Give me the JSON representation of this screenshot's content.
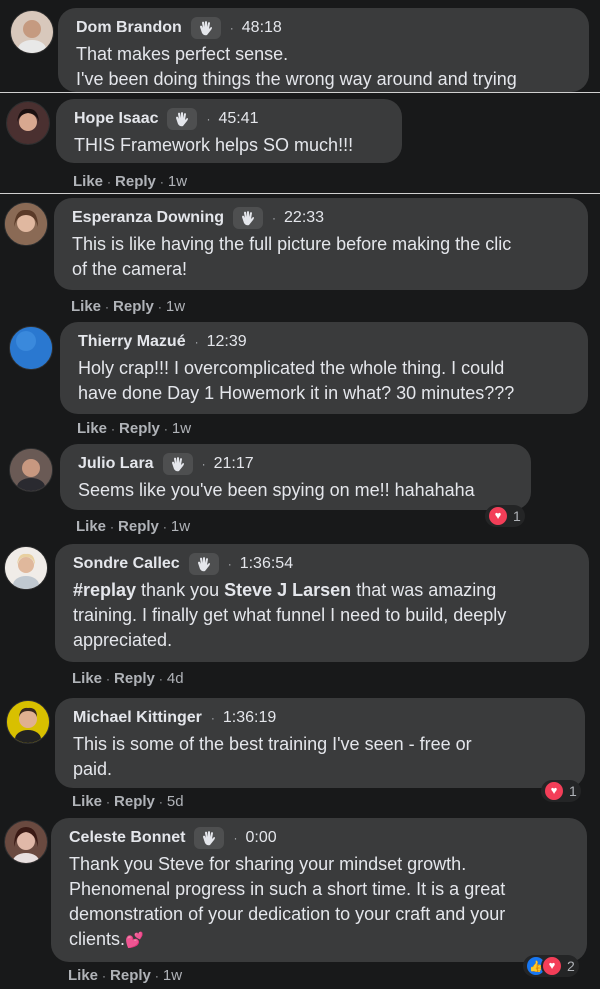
{
  "comments": [
    {
      "name": "Dom Brandon",
      "badge": true,
      "time": "48:18",
      "text_lines": [
        "That makes perfect sense.",
        "I've been doing things the wrong way around and trying"
      ],
      "avatar_color": "#c9b5a5",
      "cut": true
    },
    {
      "name": "Hope Isaac",
      "badge": true,
      "time": "45:41",
      "text_lines": [
        "THIS Framework helps SO much!!!"
      ],
      "actions": {
        "like": "Like",
        "reply": "Reply",
        "age": "1w"
      },
      "avatar_color": "#3a2a2a"
    },
    {
      "name": "Esperanza Downing",
      "badge": true,
      "time": "22:33",
      "text_lines": [
        "This is like having the full picture before making the clic",
        "of the camera!"
      ],
      "actions": {
        "like": "Like",
        "reply": "Reply",
        "age": "1w"
      },
      "avatar_color": "#9a7a60"
    },
    {
      "name": "Thierry Mazué",
      "badge": false,
      "time": "12:39",
      "text_lines": [
        "Holy crap!!! I overcomplicated the whole thing. I could",
        "have done Day 1 Howemork it in what? 30 minutes???"
      ],
      "actions": {
        "like": "Like",
        "reply": "Reply",
        "age": "1w"
      },
      "avatar_color": "#2f7fd6"
    },
    {
      "name": "Julio Lara",
      "badge": true,
      "time": "21:17",
      "text_lines": [
        "Seems like you've been spying on me!! hahahaha"
      ],
      "actions": {
        "like": "Like",
        "reply": "Reply",
        "age": "1w"
      },
      "reaction_count": "1",
      "avatar_color": "#7a6a60"
    },
    {
      "name": "Sondre Callec",
      "badge": true,
      "time": "1:36:54",
      "text_pre": "#replay",
      "text_mid": " thank you ",
      "text_mention": "Steve J Larsen",
      "text_rest_1": " that was amazing",
      "text_lines": [
        "training. I finally get what funnel I need to build, deeply",
        "appreciated."
      ],
      "actions": {
        "like": "Like",
        "reply": "Reply",
        "age": "4d"
      },
      "avatar_color": "#e8e0d8"
    },
    {
      "name": "Michael Kittinger",
      "badge": false,
      "time": "1:36:19",
      "text_lines": [
        "This is some of the best training I've seen - free or",
        "paid."
      ],
      "actions": {
        "like": "Like",
        "reply": "Reply",
        "age": "5d"
      },
      "reaction_count": "1",
      "avatar_color": "#d4b800"
    },
    {
      "name": "Celeste Bonnet",
      "badge": true,
      "time": "0:00",
      "text_lines": [
        "Thank you Steve for sharing your mindset growth.",
        "Phenomenal progress in such a short time. It is a great",
        "demonstration of your dedication to your craft and your",
        "clients."
      ],
      "emoji": "💕",
      "actions": {
        "like": "Like",
        "reply": "Reply",
        "age": "1w"
      },
      "reaction_count": "2",
      "avatar_color": "#5a3a35"
    }
  ],
  "colors": {
    "background": "#18191a",
    "bubble": "#3a3b3c",
    "love": "#f33e58",
    "like": "#1877f2"
  },
  "icons": {
    "badge": "waving-hand-icon",
    "love": "heart-icon",
    "like": "thumbs-up-icon"
  }
}
